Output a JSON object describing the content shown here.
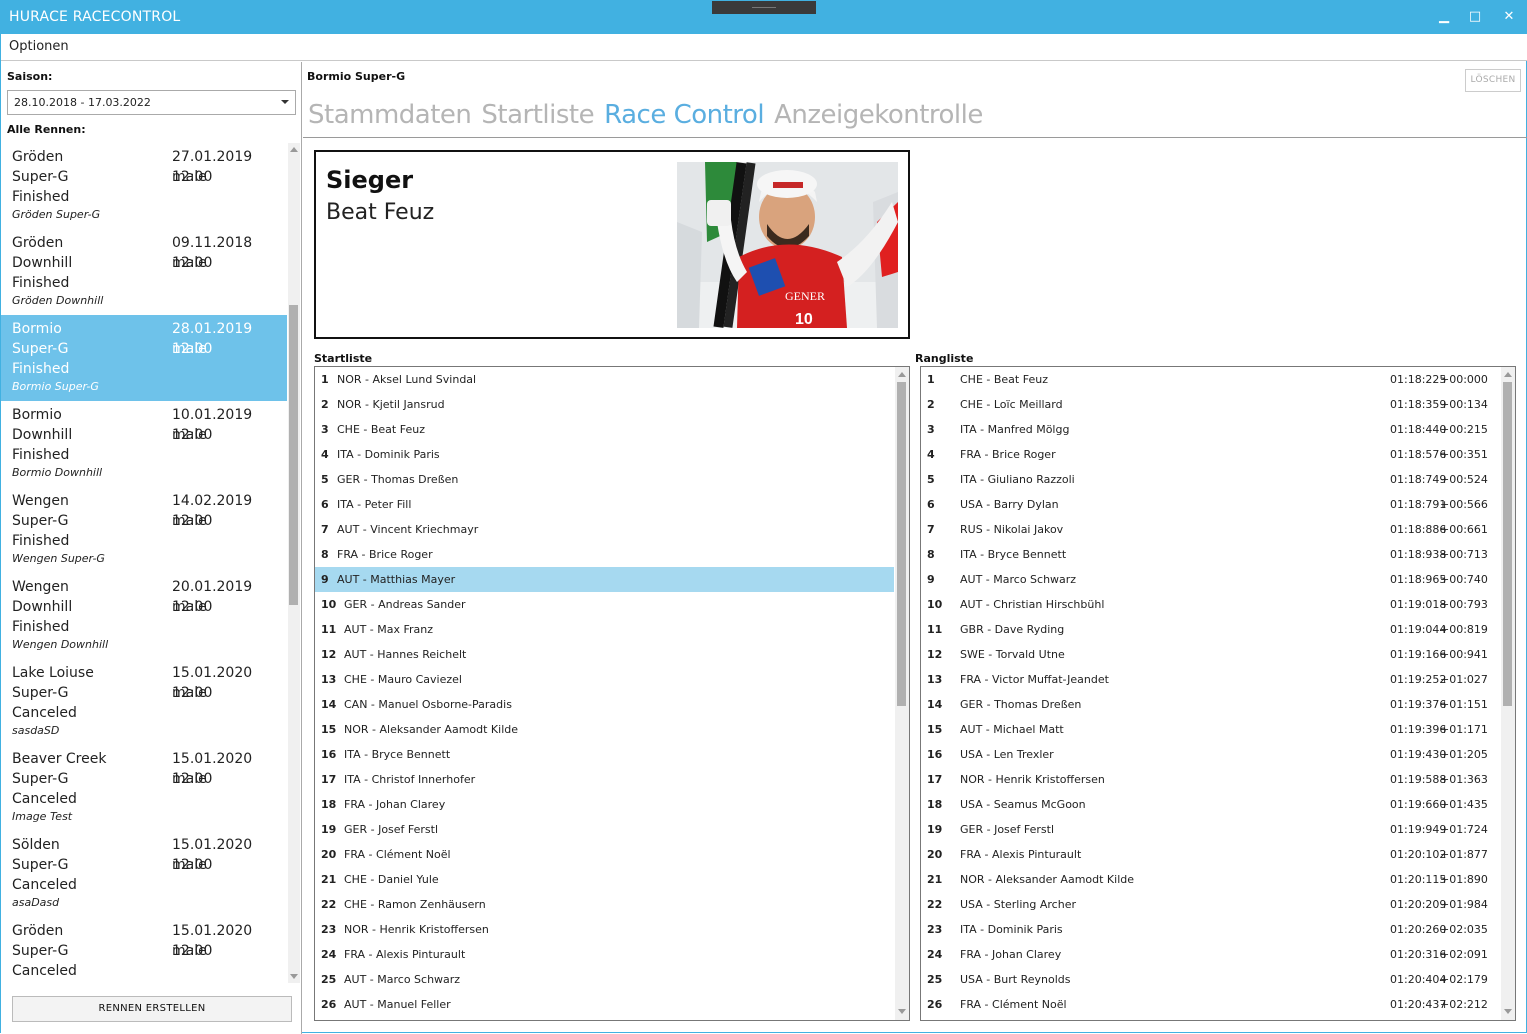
{
  "window": {
    "title": "HURACE RACECONTROL",
    "minimize": "▁",
    "maximize": "□",
    "close": "✕"
  },
  "menu": {
    "optionen": "Optionen"
  },
  "sidebar": {
    "season_label": "Saison:",
    "season_value": "28.10.2018  -  17.03.2022",
    "all_races_label": "Alle Rennen:",
    "races": [
      {
        "location": "Gröden",
        "type": "Super-G",
        "status": "Finished",
        "description": "Gröden Super-G",
        "datetime": "27.01.2019 12:00",
        "gender": "male"
      },
      {
        "location": "Gröden",
        "type": "Downhill",
        "status": "Finished",
        "description": "Gröden Downhill",
        "datetime": "09.11.2018 12:00",
        "gender": "male"
      },
      {
        "location": "Bormio",
        "type": "Super-G",
        "status": "Finished",
        "description": "Bormio Super-G",
        "datetime": "28.01.2019 12:00",
        "gender": "male"
      },
      {
        "location": "Bormio",
        "type": "Downhill",
        "status": "Finished",
        "description": "Bormio Downhill",
        "datetime": "10.01.2019 12:00",
        "gender": "male"
      },
      {
        "location": "Wengen",
        "type": "Super-G",
        "status": "Finished",
        "description": "Wengen Super-G",
        "datetime": "14.02.2019 12:00",
        "gender": "male"
      },
      {
        "location": "Wengen",
        "type": "Downhill",
        "status": "Finished",
        "description": "Wengen Downhill",
        "datetime": "20.01.2019 12:00",
        "gender": "male"
      },
      {
        "location": "Lake Loiuse",
        "type": "Super-G",
        "status": "Canceled",
        "description": "sasdaSD",
        "datetime": "15.01.2020 12:00",
        "gender": "male"
      },
      {
        "location": "Beaver Creek",
        "type": "Super-G",
        "status": "Canceled",
        "description": "Image Test",
        "datetime": "15.01.2020 12:00",
        "gender": "male"
      },
      {
        "location": "Sölden",
        "type": "Super-G",
        "status": "Canceled",
        "description": "asaDasd",
        "datetime": "15.01.2020 12:00",
        "gender": "male"
      },
      {
        "location": "Gröden",
        "type": "Super-G",
        "status": "Canceled",
        "description": "",
        "datetime": "15.01.2020 12:00",
        "gender": "male"
      }
    ],
    "selected_index": 2,
    "create_button": "RENNEN ERSTELLEN"
  },
  "main": {
    "race_title": "Bormio Super-G",
    "delete_button": "LÖSCHEN",
    "tabs": [
      {
        "label": "Stammdaten",
        "active": false
      },
      {
        "label": "Startliste",
        "active": false
      },
      {
        "label": "Race Control",
        "active": true
      },
      {
        "label": "Anzeigekontrolle",
        "active": false
      }
    ],
    "winner": {
      "heading": "Sieger",
      "name": "Beat Feuz"
    },
    "startlist_label": "Startliste",
    "ranking_label": "Rangliste",
    "startlist_selected": 9,
    "startlist": [
      "NOR  -  Aksel Lund Svindal",
      "NOR  -  Kjetil Jansrud",
      "CHE  -  Beat Feuz",
      "ITA  -  Dominik Paris",
      "GER  -  Thomas Dreßen",
      "ITA  -  Peter Fill",
      "AUT  -  Vincent Kriechmayr",
      "FRA  -  Brice Roger",
      "AUT  -  Matthias Mayer",
      "GER  -  Andreas Sander",
      "AUT  -  Max Franz",
      "AUT  -  Hannes Reichelt",
      "CHE  -  Mauro Caviezel",
      "CAN  -  Manuel Osborne-Paradis",
      "NOR  -  Aleksander Aamodt Kilde",
      "ITA  -  Bryce Bennett",
      "ITA  -  Christof Innerhofer",
      "FRA  -  Johan Clarey",
      "GER  -  Josef Ferstl",
      "FRA  -  Clément Noël",
      "CHE  -  Daniel Yule",
      "CHE  -  Ramon Zenhäusern",
      "NOR  -  Henrik Kristoffersen",
      "FRA  -  Alexis Pinturault",
      "AUT  -  Marco Schwarz",
      "AUT  -  Manuel Feller"
    ],
    "ranking": [
      {
        "racer": "CHE  -  Beat Feuz",
        "time": "01:18:225",
        "diff": "+00:000"
      },
      {
        "racer": "CHE  -  Loïc Meillard",
        "time": "01:18:359",
        "diff": "+00:134"
      },
      {
        "racer": "ITA  -  Manfred Mölgg",
        "time": "01:18:440",
        "diff": "+00:215"
      },
      {
        "racer": "FRA  -  Brice Roger",
        "time": "01:18:576",
        "diff": "+00:351"
      },
      {
        "racer": "ITA  -  Giuliano Razzoli",
        "time": "01:18:749",
        "diff": "+00:524"
      },
      {
        "racer": "USA  -  Barry Dylan",
        "time": "01:18:791",
        "diff": "+00:566"
      },
      {
        "racer": "RUS  -  Nikolai Jakov",
        "time": "01:18:886",
        "diff": "+00:661"
      },
      {
        "racer": "ITA  -  Bryce Bennett",
        "time": "01:18:938",
        "diff": "+00:713"
      },
      {
        "racer": "AUT  -  Marco Schwarz",
        "time": "01:18:965",
        "diff": "+00:740"
      },
      {
        "racer": "AUT  -  Christian Hirschbühl",
        "time": "01:19:018",
        "diff": "+00:793"
      },
      {
        "racer": "GBR  -  Dave Ryding",
        "time": "01:19:044",
        "diff": "+00:819"
      },
      {
        "racer": "SWE  -  Torvald Utne",
        "time": "01:19:166",
        "diff": "+00:941"
      },
      {
        "racer": "FRA  -  Victor Muffat-Jeandet",
        "time": "01:19:252",
        "diff": "+01:027"
      },
      {
        "racer": "GER  -  Thomas Dreßen",
        "time": "01:19:376",
        "diff": "+01:151"
      },
      {
        "racer": "AUT  -  Michael Matt",
        "time": "01:19:396",
        "diff": "+01:171"
      },
      {
        "racer": "USA  -  Len Trexler",
        "time": "01:19:430",
        "diff": "+01:205"
      },
      {
        "racer": "NOR  -  Henrik Kristoffersen",
        "time": "01:19:588",
        "diff": "+01:363"
      },
      {
        "racer": "USA  -  Seamus McGoon",
        "time": "01:19:660",
        "diff": "+01:435"
      },
      {
        "racer": "GER  -  Josef Ferstl",
        "time": "01:19:949",
        "diff": "+01:724"
      },
      {
        "racer": "FRA  -  Alexis Pinturault",
        "time": "01:20:102",
        "diff": "+01:877"
      },
      {
        "racer": "NOR  -  Aleksander Aamodt Kilde",
        "time": "01:20:115",
        "diff": "+01:890"
      },
      {
        "racer": "USA  -  Sterling Archer",
        "time": "01:20:209",
        "diff": "+01:984"
      },
      {
        "racer": "ITA  -  Dominik Paris",
        "time": "01:20:260",
        "diff": "+02:035"
      },
      {
        "racer": "FRA  -  Johan Clarey",
        "time": "01:20:316",
        "diff": "+02:091"
      },
      {
        "racer": "USA  -  Burt Reynolds",
        "time": "01:20:404",
        "diff": "+02:179"
      },
      {
        "racer": "FRA  -  Clément Noël",
        "time": "01:20:437",
        "diff": "+02:212"
      }
    ]
  },
  "colors": {
    "accent": "#41b1e1",
    "selected": "#6ec2ea",
    "tab_active": "#5aaee0",
    "row_highlight": "#a6d9f0"
  }
}
